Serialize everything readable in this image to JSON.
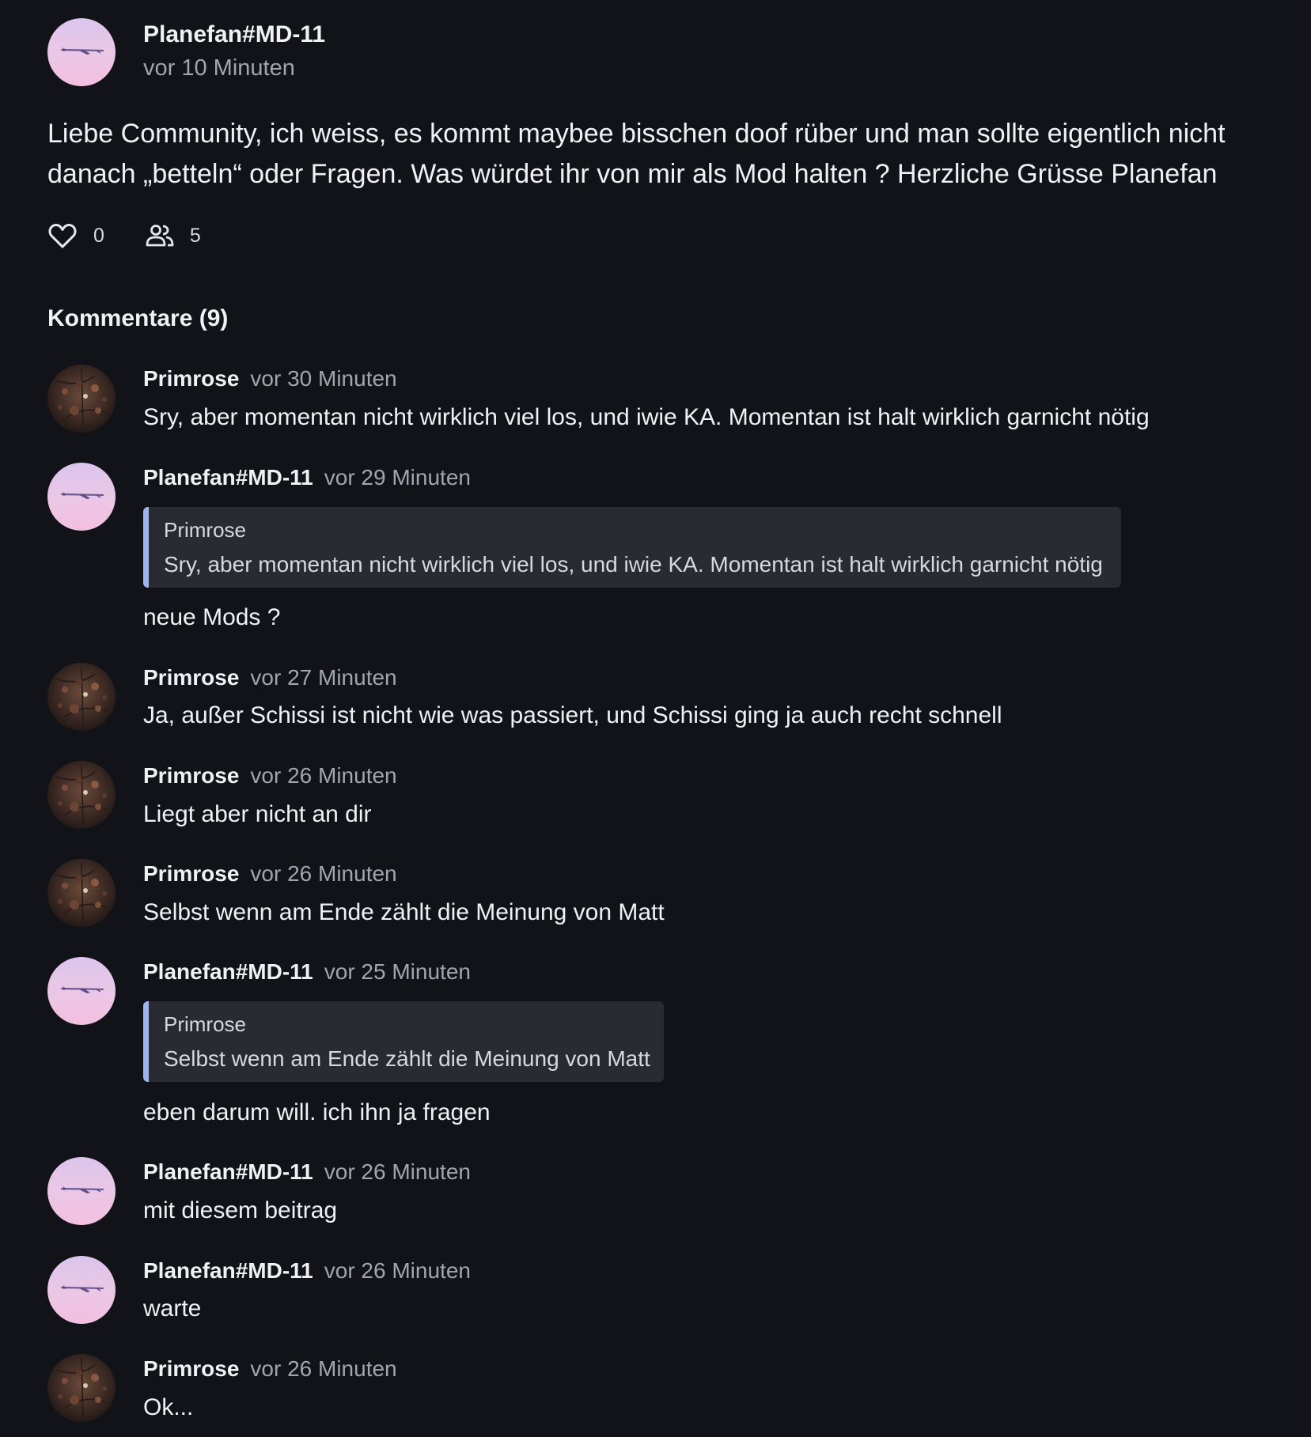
{
  "post": {
    "author": "Planefan#MD-11",
    "time": "vor 10 Minuten",
    "body": "Liebe Community, ich weiss, es kommt maybee bisschen doof rüber und man sollte eigentlich nicht danach „betteln“ oder Fragen. Was würdet ihr von mir als Mod halten ? Herzliche Grüsse Planefan",
    "likes": "0",
    "participants": "5",
    "like_icon": "heart-outline-icon",
    "participants_icon": "people-icon"
  },
  "comments_heading": "Kommentare (9)",
  "comments": [
    {
      "author": "Primrose",
      "time": "vor 30 Minuten",
      "text": "Sry, aber momentan nicht wirklich viel los, und iwie KA. Momentan ist halt wirklich garnicht nötig"
    },
    {
      "author": "Planefan#MD-11",
      "time": "vor 29 Minuten",
      "quote": {
        "author": "Primrose",
        "text": "Sry, aber momentan nicht wirklich viel los, und iwie KA. Momentan ist halt wirklich garnicht nötig"
      },
      "text": "neue Mods ?"
    },
    {
      "author": "Primrose",
      "time": "vor 27 Minuten",
      "text": "Ja, außer Schissi ist nicht wie was passiert, und Schissi ging ja auch recht schnell"
    },
    {
      "author": "Primrose",
      "time": "vor 26 Minuten",
      "text": "Liegt aber nicht an dir"
    },
    {
      "author": "Primrose",
      "time": "vor 26 Minuten",
      "text": "Selbst wenn am Ende zählt die Meinung von Matt"
    },
    {
      "author": "Planefan#MD-11",
      "time": "vor 25 Minuten",
      "quote": {
        "author": "Primrose",
        "text": "Selbst wenn am Ende zählt die Meinung von Matt"
      },
      "text": "eben darum will. ich ihn ja fragen"
    },
    {
      "author": "Planefan#MD-11",
      "time": "vor 26 Minuten",
      "text": "mit diesem beitrag"
    },
    {
      "author": "Planefan#MD-11",
      "time": "vor 26 Minuten",
      "text": "warte"
    },
    {
      "author": "Primrose",
      "time": "vor 26 Minuten",
      "text": "Ok..."
    }
  ],
  "colors": {
    "background": "#121319",
    "quote_background": "#2a2b32",
    "quote_accent": "#9db4ef",
    "muted_text": "#a3a4ad"
  }
}
